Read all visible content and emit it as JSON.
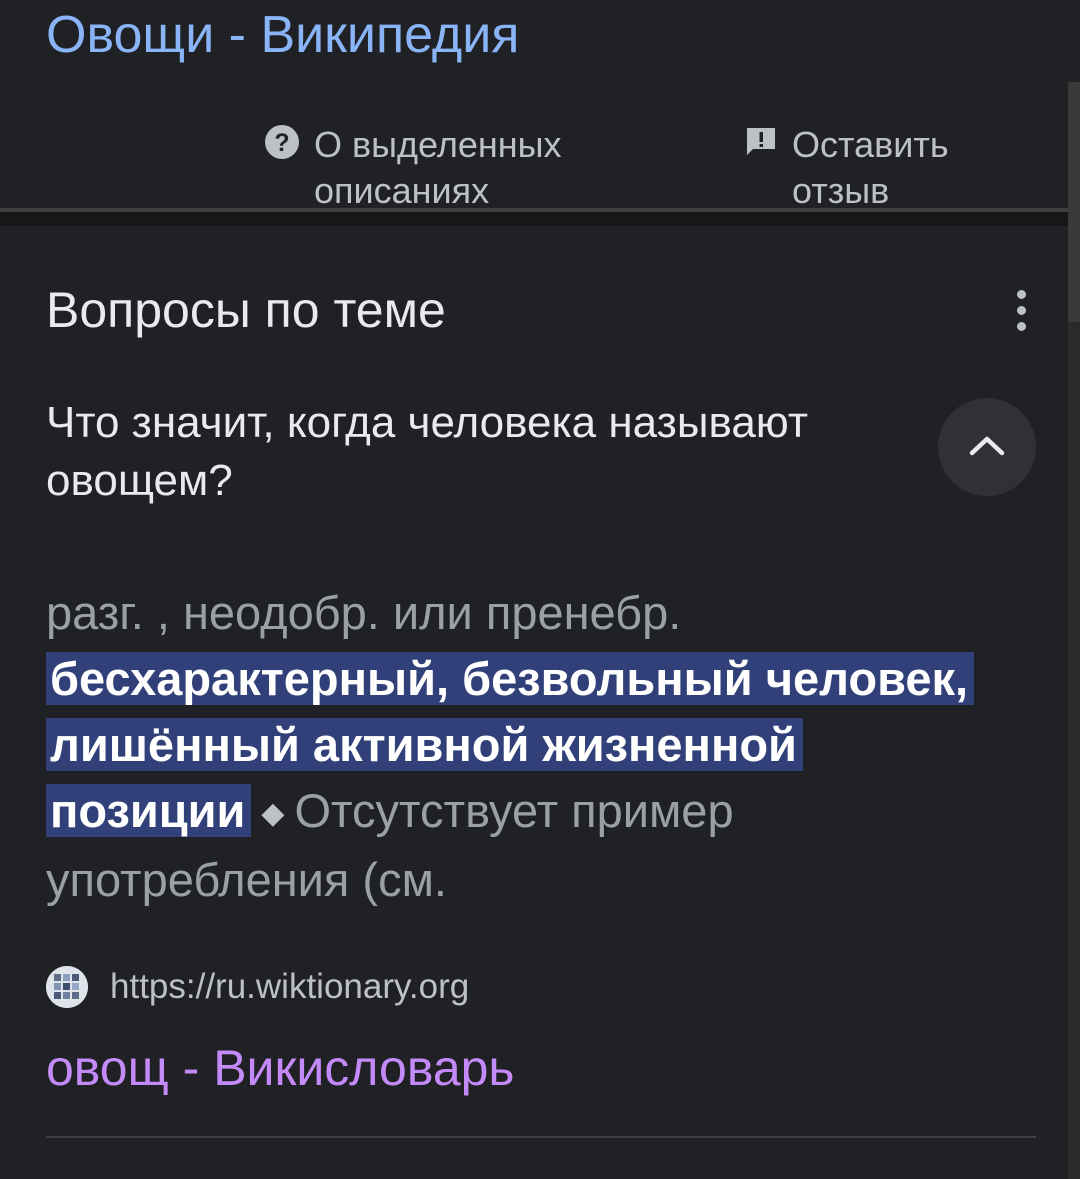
{
  "top_result": {
    "title": "Овощи - Википедия"
  },
  "feedback": {
    "about_label": "О выделенных описаниях",
    "about_icon": "help-circle-icon",
    "feedback_label": "Оставить отзыв",
    "feedback_icon": "feedback-icon"
  },
  "related_questions": {
    "title": "Вопросы по теме",
    "more_icon": "more-vert-icon",
    "question": "Что значит, когда человека называют овощем?",
    "collapse_icon": "chevron-up-icon",
    "answer_prefix": "разг. , неодобр. или пренебр.",
    "answer_highlight": "бесхарактерный, безвольный человек, лишённый активной жизненной позиции",
    "answer_suffix": "Отсутствует пример употребления (см.",
    "source_url": "https://ru.wiktionary.org",
    "source_title": "овощ - Викисловарь"
  },
  "colors": {
    "background": "#202124",
    "link_blue": "#8ab4f8",
    "visited_purple": "#c58af9",
    "highlight_bg": "#314078"
  }
}
